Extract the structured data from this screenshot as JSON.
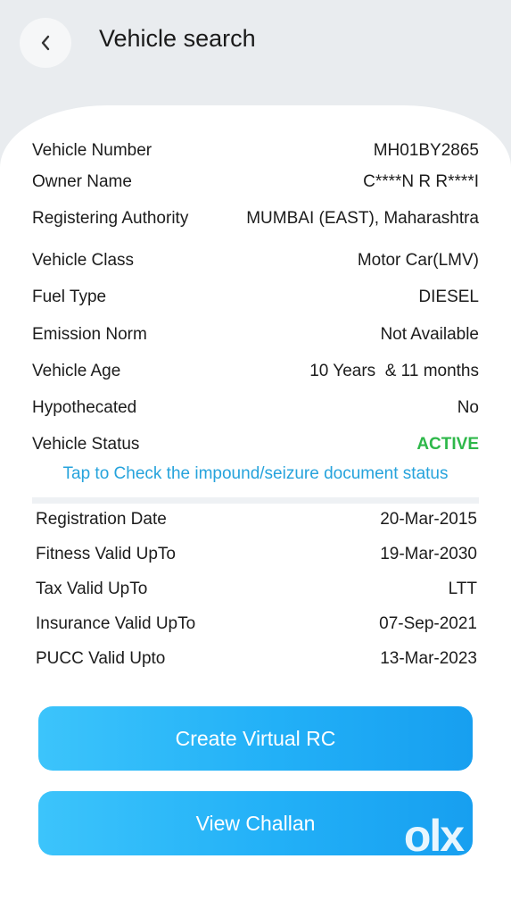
{
  "header": {
    "title": "Vehicle search",
    "back_icon": "chevron-left-icon"
  },
  "details": [
    {
      "label": "Vehicle Number",
      "value": "MH01BY2865"
    },
    {
      "label": "Owner Name",
      "value": "C****N R R****I"
    },
    {
      "label": "Registering Authority",
      "value": "MUMBAI (EAST), Maharashtra"
    },
    {
      "label": "Vehicle Class",
      "value": "Motor Car(LMV)"
    },
    {
      "label": "Fuel Type",
      "value": "DIESEL"
    },
    {
      "label": "Emission Norm",
      "value": "Not Available"
    },
    {
      "label": "Vehicle Age",
      "value": "10 Years  & 11 months"
    },
    {
      "label": "Hypothecated",
      "value": "No"
    },
    {
      "label": "Vehicle Status",
      "value": "ACTIVE"
    }
  ],
  "impound_link": "Tap to Check the impound/seizure document status",
  "validity": [
    {
      "label": "Registration Date",
      "value": "20-Mar-2015"
    },
    {
      "label": "Fitness Valid UpTo",
      "value": "19-Mar-2030"
    },
    {
      "label": "Tax Valid UpTo",
      "value": "LTT"
    },
    {
      "label": "Insurance Valid UpTo",
      "value": "07-Sep-2021"
    },
    {
      "label": "PUCC Valid Upto",
      "value": "13-Mar-2023"
    }
  ],
  "buttons": {
    "create_rc": "Create Virtual RC",
    "view_challan": "View Challan"
  },
  "watermark": "olx",
  "colors": {
    "accent": "#26a3dc",
    "status_active": "#2eb84a",
    "button": "#22b0f7"
  }
}
